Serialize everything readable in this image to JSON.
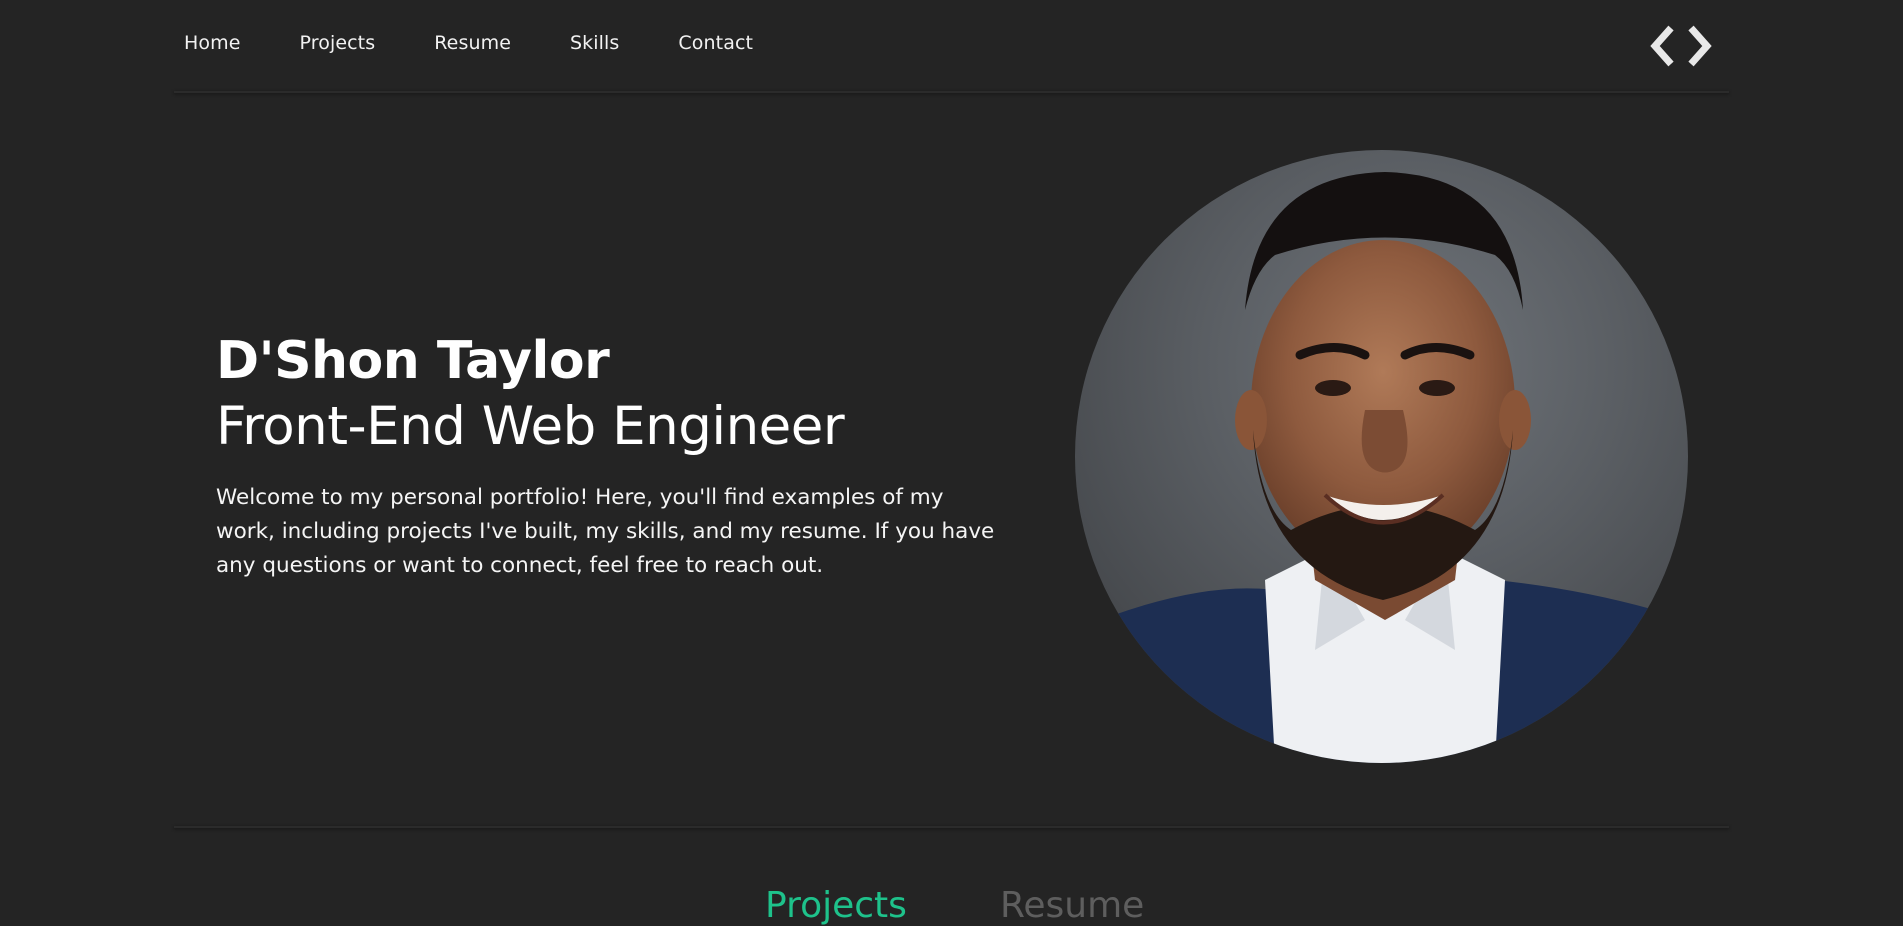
{
  "nav": {
    "links": [
      {
        "label": "Home"
      },
      {
        "label": "Projects"
      },
      {
        "label": "Resume"
      },
      {
        "label": "Skills"
      },
      {
        "label": "Contact"
      }
    ],
    "logo_icon": "code-brackets-icon"
  },
  "hero": {
    "name": "D'Shon Taylor",
    "role": "Front-End Web Engineer",
    "intro": "Welcome to my personal portfolio! Here, you'll find examples of my work, including projects I've built, my skills, and my resume. If you have any questions or want to connect, feel free to reach out."
  },
  "sections": {
    "tabs": [
      {
        "label": "Projects",
        "active": true
      },
      {
        "label": "Resume",
        "active": false
      }
    ]
  },
  "colors": {
    "background": "#242424",
    "accent": "#1ec28b",
    "inactive_tab": "#5e5e5e",
    "text": "#ffffff"
  }
}
